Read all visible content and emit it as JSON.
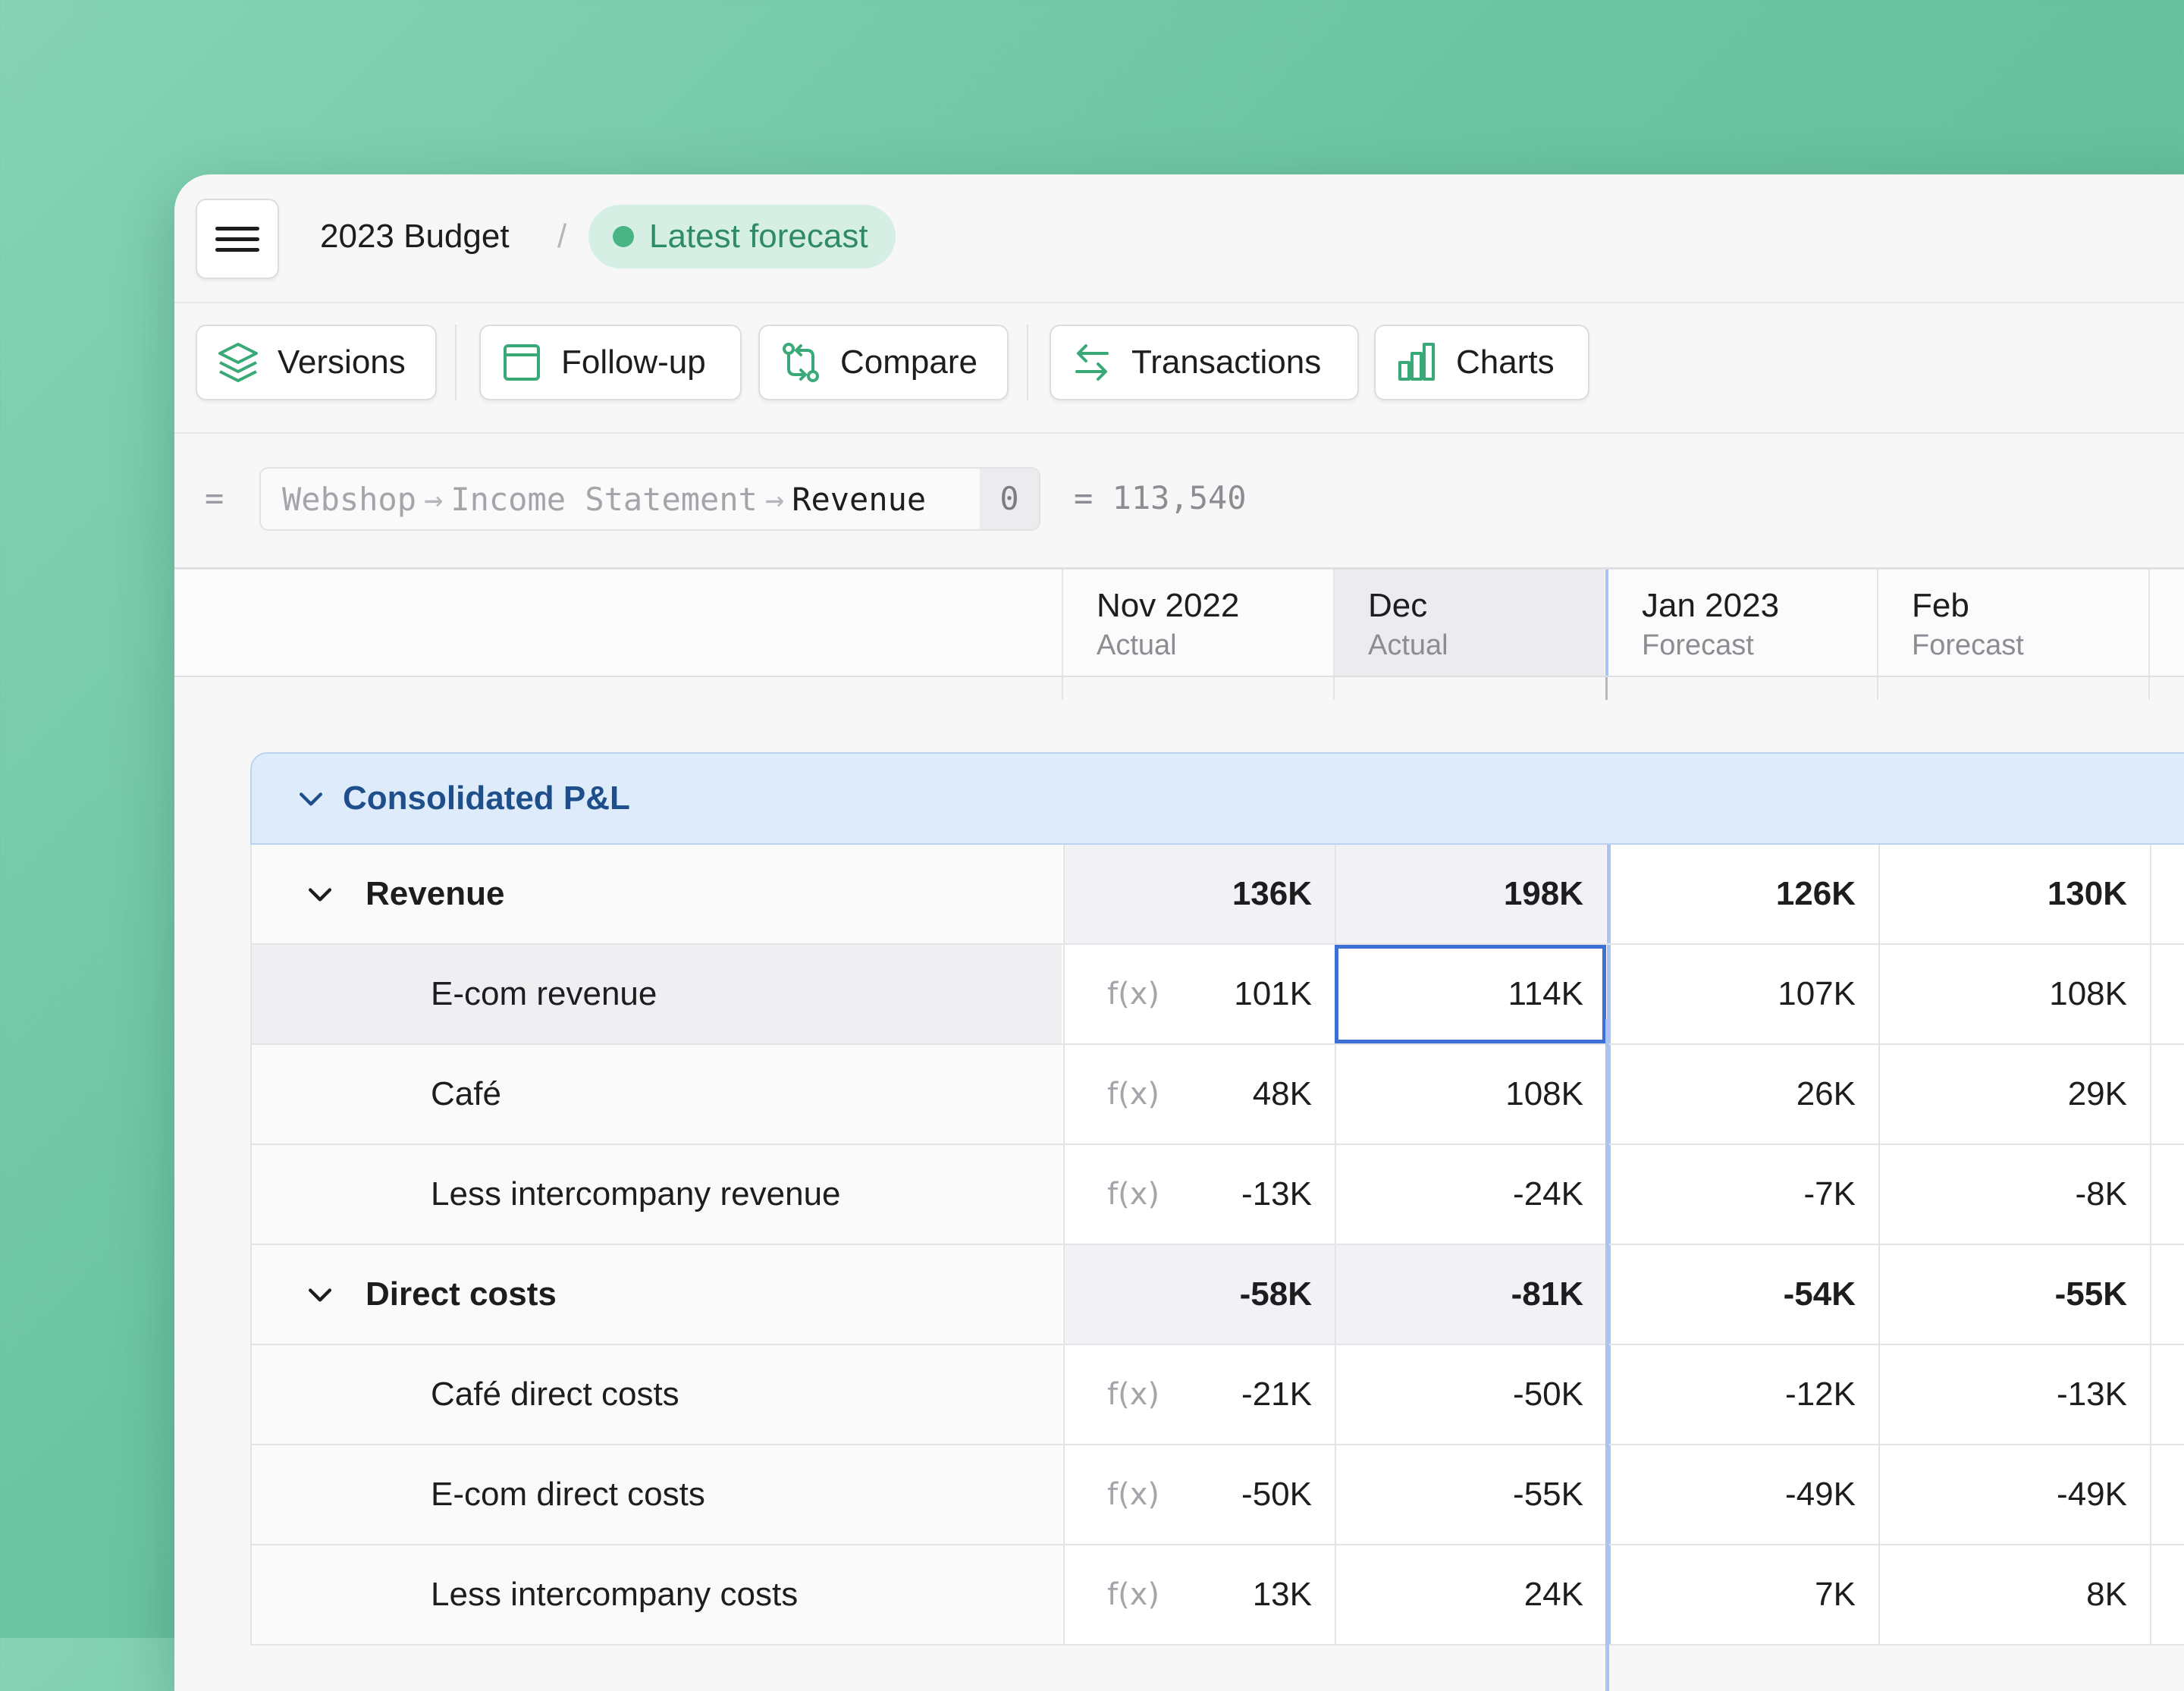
{
  "header": {
    "title": "2023 Budget",
    "separator": "/",
    "forecast_label": "Latest forecast"
  },
  "toolbar": {
    "versions": "Versions",
    "followup": "Follow-up",
    "compare": "Compare",
    "transactions": "Transactions",
    "charts": "Charts"
  },
  "formula": {
    "prefix": "=",
    "path1": "Webshop",
    "path2": "Income Statement",
    "current": "Revenue",
    "index": "0",
    "result": "= 113,540"
  },
  "columns": [
    {
      "month": "Nov 2022",
      "type": "Actual"
    },
    {
      "month": "Dec",
      "type": "Actual"
    },
    {
      "month": "Jan 2023",
      "type": "Forecast"
    },
    {
      "month": "Feb",
      "type": "Forecast"
    }
  ],
  "section": {
    "title": "Consolidated P&L"
  },
  "rows": [
    {
      "name": "Revenue",
      "fx": "",
      "values": [
        "136K",
        "198K",
        "126K",
        "130K"
      ]
    },
    {
      "name": "E-com revenue",
      "fx": "f(x)",
      "values": [
        "101K",
        "114K",
        "107K",
        "108K"
      ]
    },
    {
      "name": "Café",
      "fx": "f(x)",
      "values": [
        "48K",
        "108K",
        "26K",
        "29K"
      ]
    },
    {
      "name": "Less intercompany revenue",
      "fx": "f(x)",
      "values": [
        "-13K",
        "-24K",
        "-7K",
        "-8K"
      ]
    },
    {
      "name": "Direct costs",
      "fx": "",
      "values": [
        "-58K",
        "-81K",
        "-54K",
        "-55K"
      ]
    },
    {
      "name": "Café direct costs",
      "fx": "f(x)",
      "values": [
        "-21K",
        "-50K",
        "-12K",
        "-13K"
      ]
    },
    {
      "name": "E-com direct costs",
      "fx": "f(x)",
      "values": [
        "-50K",
        "-55K",
        "-49K",
        "-49K"
      ]
    },
    {
      "name": "Less intercompany costs",
      "fx": "f(x)",
      "values": [
        "13K",
        "24K",
        "7K",
        "8K"
      ]
    }
  ],
  "colors": {
    "accent_green": "#49b485",
    "section_blue": "#1f4f8a",
    "selection_blue": "#3d6fd6"
  },
  "icons": {
    "menu": "hamburger-icon",
    "versions": "layers-icon",
    "followup": "calendar-icon",
    "compare": "git-compare-icon",
    "transactions": "arrows-swap-icon",
    "charts": "bar-chart-icon",
    "collapse": "chevron-down-icon"
  }
}
